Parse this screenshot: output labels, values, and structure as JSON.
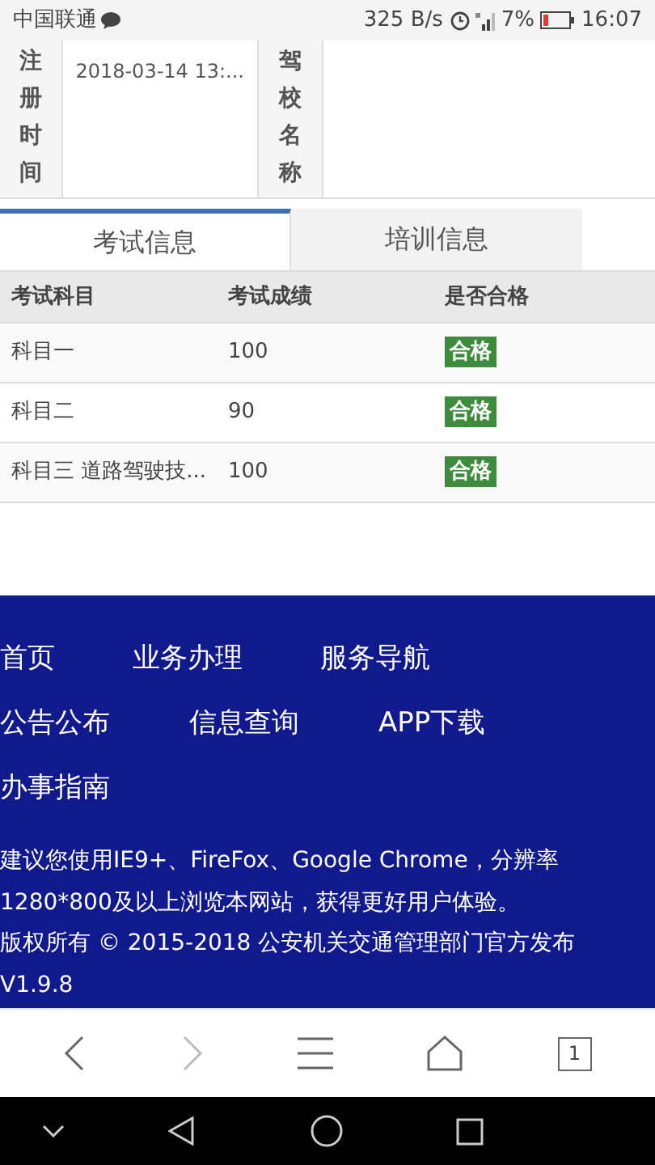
{
  "status_bar": {
    "carrier": "中国联通",
    "speed": "325 B/s",
    "battery": "7%",
    "time": "16:07"
  },
  "info_table": [
    {
      "label": "注册时间",
      "value": "2018-03-14 13:..."
    },
    {
      "label": "驾校名称"
    }
  ],
  "tabs": [
    {
      "label": "考试信息",
      "selected": true
    },
    {
      "label": "培训信息",
      "selected": false
    }
  ],
  "exam_table": {
    "columns": [
      "考试科目",
      "考试成绩",
      "是否合格"
    ],
    "rows": [
      {
        "subject": "科目一",
        "score": "100",
        "result": "合格"
      },
      {
        "subject": "科目二",
        "score": "90",
        "result": "合格"
      },
      {
        "subject": "科目三 道路驾驶技...",
        "score": "100",
        "result": "合格"
      }
    ]
  },
  "footer": {
    "links": [
      [
        "首页",
        "业务办理",
        "服务导航"
      ],
      [
        "公告公布",
        "信息查询",
        "APP下载"
      ],
      [
        "办事指南"
      ]
    ],
    "lines": [
      "建议您使用IE9+、FireFox、Google Chrome，分辨率",
      "1280*800及以上浏览本网站，获得更好用户体验。",
      "版权所有 © 2015-2018 公安机关交通管理部门官方发布",
      "V1.9.8"
    ]
  },
  "browser_bar": {
    "tab_count": "1"
  }
}
